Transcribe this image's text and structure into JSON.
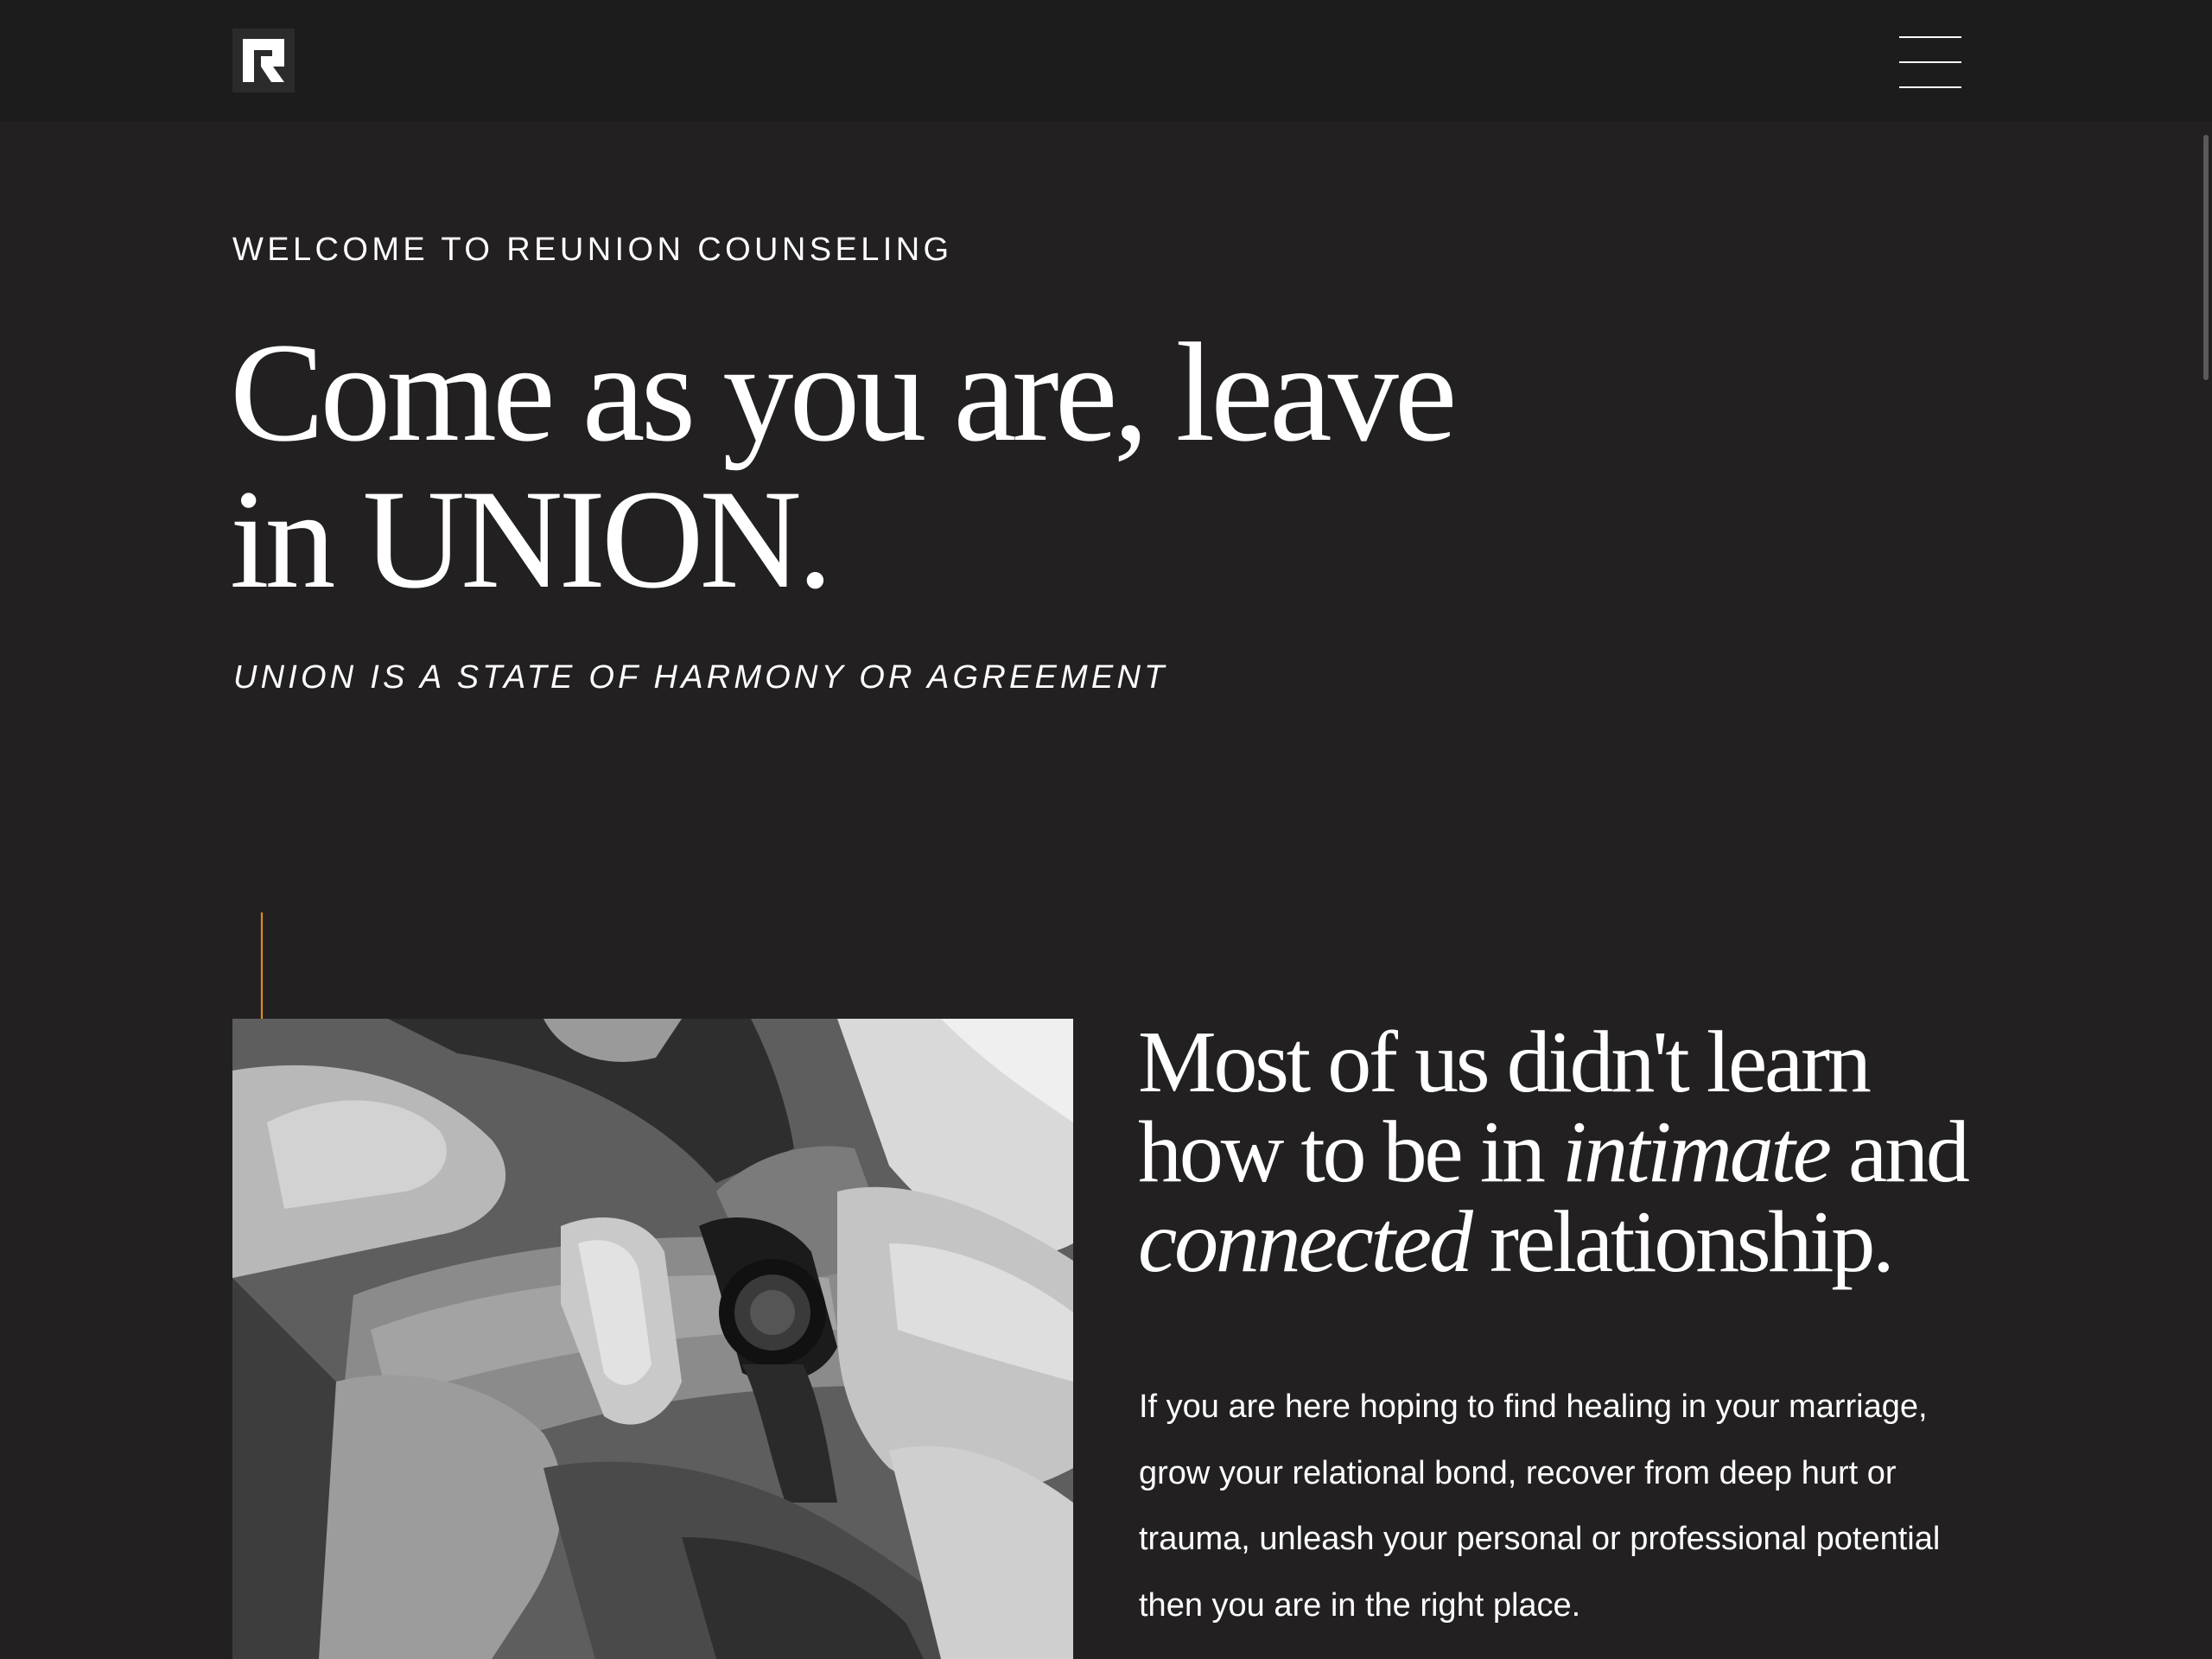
{
  "header": {
    "logo_alt": "Reunion Counseling logo",
    "menu_label": "Menu"
  },
  "hero": {
    "eyebrow": "WELCOME TO REUNION COUNSELING",
    "headline_line1": "Come as you are, leave",
    "headline_line2": "in UNION.",
    "tagline": "UNION IS A STATE OF HARMONY OR AGREEMENT"
  },
  "intro": {
    "image_alt": "Black and white photo of two people embracing, hands clasped over an arm wearing a wristwatch",
    "heading_part1": "Most of us didn't learn how to be in ",
    "heading_em1": "intimate",
    "heading_part2": " and ",
    "heading_em2": "connected",
    "heading_part3": " relationship.",
    "body": "If you are here hoping to find healing in your marriage, grow your relational bond, recover from deep hurt or trauma, unleash your personal or professional potential then you are in the right place."
  },
  "colors": {
    "background": "#222021",
    "header_background": "#1c1c1d",
    "accent": "#e08a1e",
    "text": "#ffffff"
  },
  "icons": {
    "logo": "reunion-r-logo-icon",
    "menu": "hamburger-menu-icon",
    "arrow": "arrow-down-icon"
  }
}
